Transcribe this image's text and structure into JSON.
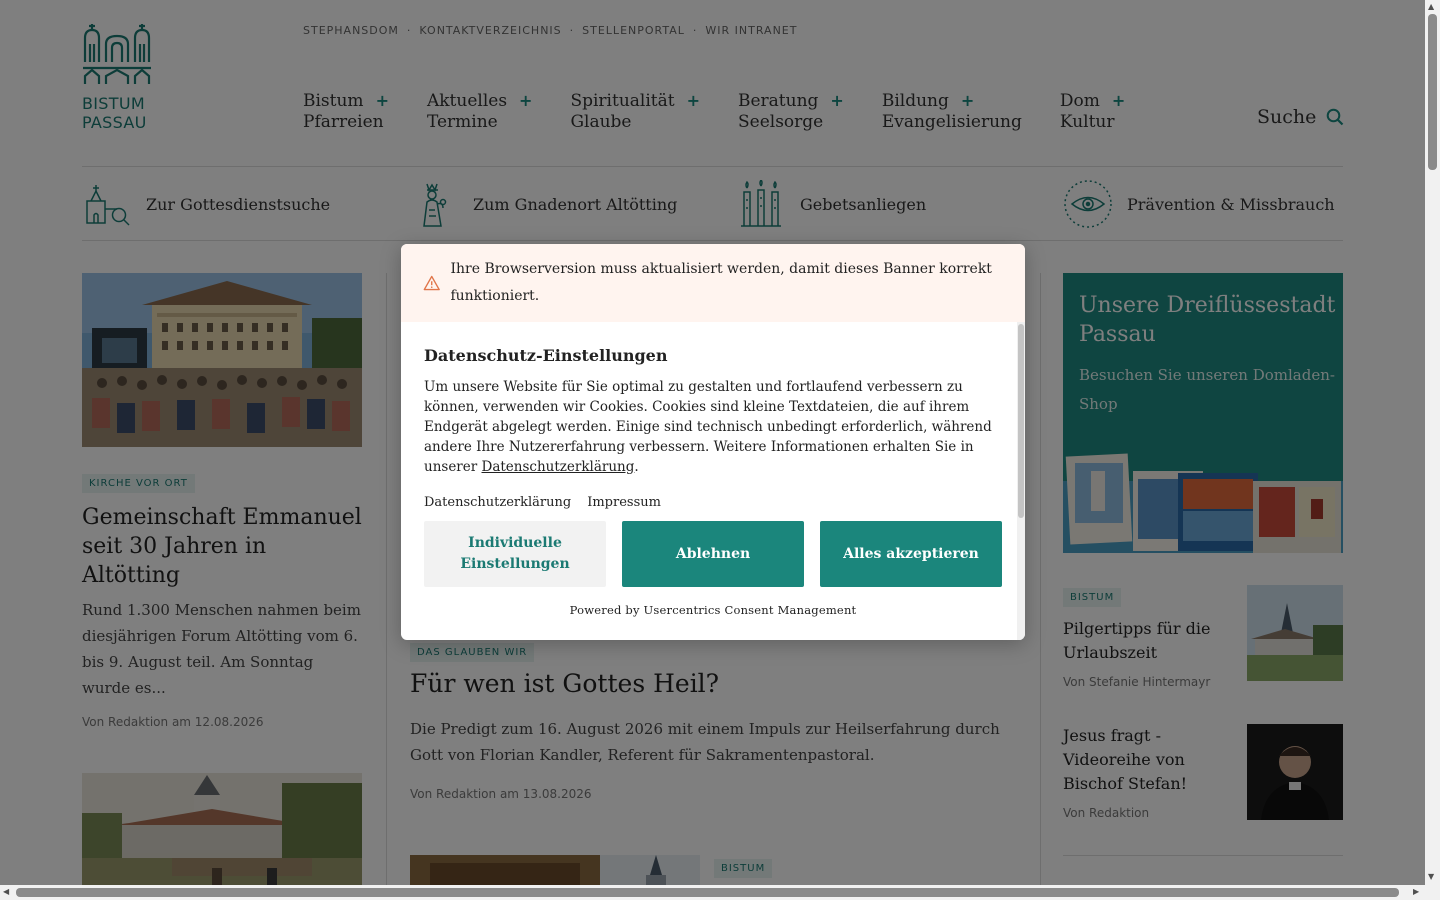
{
  "header": {
    "logo_line1": "BISTUM",
    "logo_line2": "PASSAU",
    "top_links": [
      "STEPHANSDOM",
      "KONTAKTVERZEICHNIS",
      "STELLENPORTAL",
      "WIR INTRANET"
    ],
    "nav": [
      {
        "line1": "Bistum",
        "line2": "Pfarreien"
      },
      {
        "line1": "Aktuelles",
        "line2": "Termine"
      },
      {
        "line1": "Spiritualität",
        "line2": "Glaube"
      },
      {
        "line1": "Beratung",
        "line2": "Seelsorge"
      },
      {
        "line1": "Bildung",
        "line2": "Evangelisierung"
      },
      {
        "line1": "Dom",
        "line2": "Kultur"
      }
    ],
    "nav_plus": "+",
    "search_label": "Suche"
  },
  "quicklinks": [
    {
      "label": "Zur Gottesdienstsuche",
      "icon": "church-search-icon"
    },
    {
      "label": "Zum Gnadenort Altötting",
      "icon": "madonna-icon"
    },
    {
      "label": "Gebetsanliegen",
      "icon": "candles-icon"
    },
    {
      "label": "Prävention & Missbrauch",
      "icon": "eye-icon"
    }
  ],
  "articles": {
    "left": {
      "tag": "KIRCHE VOR ORT",
      "title": "Gemeinschaft Emmanuel seit 30 Jahren in Altötting",
      "teaser": "Rund 1.300 Menschen nahmen beim diesjährigen Forum Altötting vom 6. bis 9. August teil. Am Sonntag wurde es...",
      "meta": "Von Redaktion am 12.08.2026"
    },
    "middle": {
      "tag": "DAS GLAUBEN WIR",
      "title": "Für wen ist Gottes Heil?",
      "teaser": "Die Predigt zum 16. August 2026 mit einem Impuls zur Heilserfahrung durch Gott von Florian Kandler, Referent für Sakramentenpastoral.",
      "meta": "Von Redaktion am 13.08.2026",
      "next_tag": "BISTUM"
    }
  },
  "sidebar": {
    "promo_title": "Unsere Dreiflüssestadt Passau",
    "promo_sub": "Besuchen Sie unseren Domladen-Shop",
    "items": [
      {
        "tag": "BISTUM",
        "title": "Pilgertipps für die Urlaubszeit",
        "meta": "Von Stefanie Hintermayr"
      },
      {
        "tag": "",
        "title": "Jesus fragt - Videoreihe von Bischof Stefan!",
        "meta": "Von Redaktion"
      }
    ]
  },
  "consent": {
    "warning": "Ihre Browserversion muss aktualisiert werden, damit dieses Banner korrekt funktioniert.",
    "title": "Datenschutz-Einstellungen",
    "text": "Um unsere Website für Sie optimal zu gestalten und fortlaufend verbessern zu können, verwenden wir Cookies. Cookies sind kleine Textdateien, die auf ihrem Endgerät abgelegt werden. Einige sind technisch unbedingt erforderlich, während andere Ihre Nutzererfahrung verbessern. Weitere Informationen erhalten Sie in unserer",
    "text_link": "Datenschutzerklärung",
    "text_end": ".",
    "link_privacy": "Datenschutzerklärung",
    "link_imprint": "Impressum",
    "btn_individual": "Individuelle Einstellungen",
    "btn_decline": "Ablehnen",
    "btn_accept": "Alles akzeptieren",
    "powered": "Powered by Usercentrics Consent Management"
  },
  "colors": {
    "brand": "#1b867c",
    "warning_bg": "#fff4ef",
    "warning_icon": "#e0754a"
  }
}
